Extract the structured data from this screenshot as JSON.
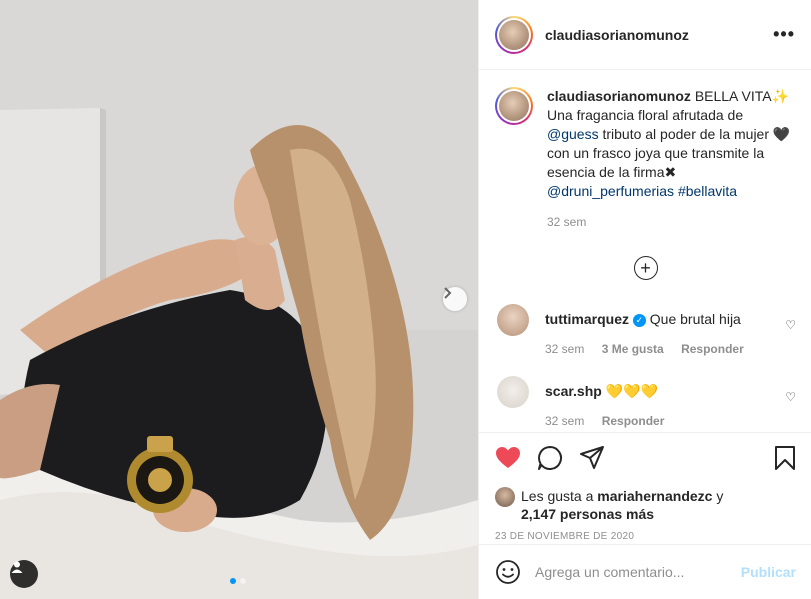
{
  "post": {
    "username": "claudiasorianomunoz",
    "more_label": "•••"
  },
  "caption": {
    "username": "claudiasorianomunoz",
    "title": "BELLA VITA",
    "title_emoji": "✨",
    "line1": "Una fragancia floral afrutada de",
    "mention1": "@guess",
    "line2": "tributo al poder de la mujer",
    "heart_emoji": "🖤",
    "line3": "con un frasco joya que transmite",
    "line4": "la esencia de la firma",
    "cross_emoji": "✖",
    "mention2": "@druni_perfumerias",
    "hashtag": "#bellavita",
    "time": "32 sem"
  },
  "comments": [
    {
      "username": "tuttimarquez",
      "verified": true,
      "text": "Que brutal hija",
      "time": "32 sem",
      "likes": "3 Me gusta",
      "reply": "Responder"
    },
    {
      "username": "scar.shp",
      "verified": false,
      "text": "💛💛💛",
      "time": "32 sem",
      "reply": "Responder"
    }
  ],
  "likes": {
    "prefix": "Les gusta a",
    "user": "mariahernandezc",
    "connector": "y",
    "count_text": "2,147 personas más"
  },
  "date": "23 DE NOVIEMBRE DE 2020",
  "add_comment": {
    "placeholder": "Agrega un comentario...",
    "publish_label": "Publicar"
  },
  "carousel": {
    "total": 2,
    "current": 1
  },
  "colors": {
    "like_red": "#ed4956",
    "link_blue": "#00376b",
    "verified_blue": "#0095f6",
    "publish_disabled": "#b2dffc"
  }
}
